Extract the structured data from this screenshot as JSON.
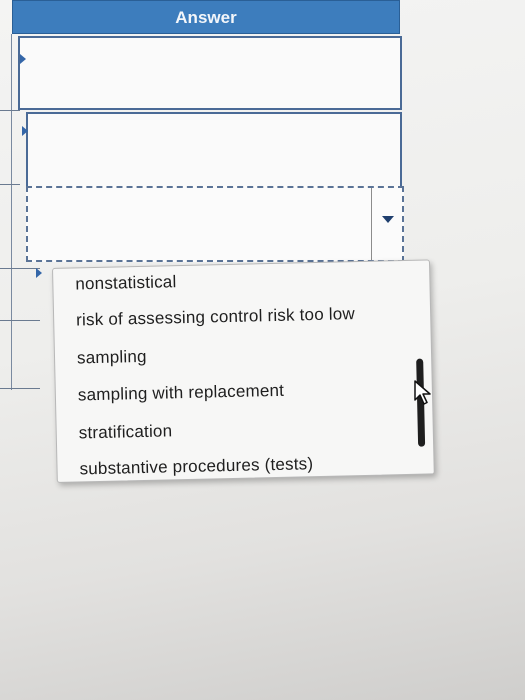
{
  "table": {
    "header": "Answer"
  },
  "dropdown": {
    "options": [
      "nonstatistical",
      "risk of assessing control risk too low",
      "sampling",
      "sampling with replacement",
      "stratification",
      "substantive procedures (tests)"
    ]
  },
  "colors": {
    "header_bg": "#3d7dbd",
    "header_text": "#f3f6fa",
    "border": "#4a6a96"
  },
  "icons": {
    "select_arrow": "chevron-down-icon",
    "cursor": "mouse-pointer-icon"
  }
}
